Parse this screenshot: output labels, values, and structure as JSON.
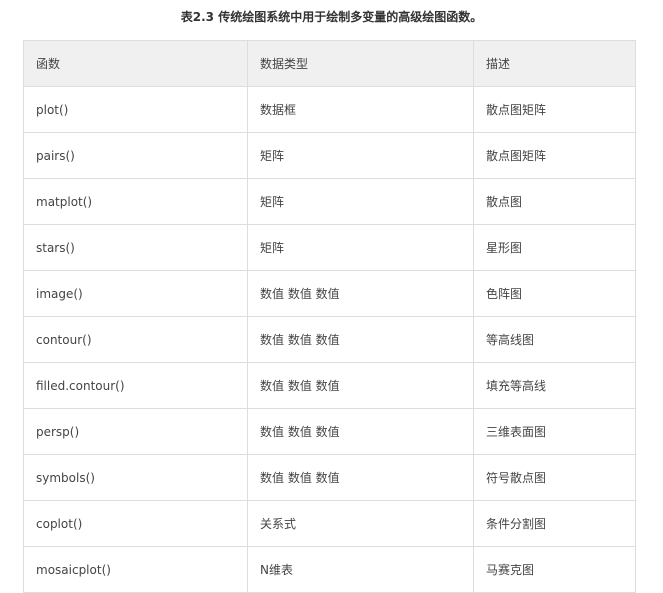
{
  "caption": "表2.3 传统绘图系统中用于绘制多变量的高级绘图函数。",
  "table": {
    "headers": [
      "函数",
      "数据类型",
      "描述"
    ],
    "rows": [
      [
        "plot()",
        "数据框",
        "散点图矩阵"
      ],
      [
        "pairs()",
        "矩阵",
        "散点图矩阵"
      ],
      [
        "matplot()",
        "矩阵",
        "散点图"
      ],
      [
        "stars()",
        "矩阵",
        "星形图"
      ],
      [
        "image()",
        "数值 数值 数值",
        "色阵图"
      ],
      [
        "contour()",
        "数值 数值 数值",
        "等高线图"
      ],
      [
        "filled.contour()",
        "数值 数值 数值",
        "填充等高线"
      ],
      [
        "persp()",
        "数值 数值 数值",
        "三维表面图"
      ],
      [
        "symbols()",
        "数值 数值 数值",
        "符号散点图"
      ],
      [
        "coplot()",
        "关系式",
        "条件分割图"
      ],
      [
        "mosaicplot()",
        "N维表",
        "马赛克图"
      ]
    ]
  }
}
